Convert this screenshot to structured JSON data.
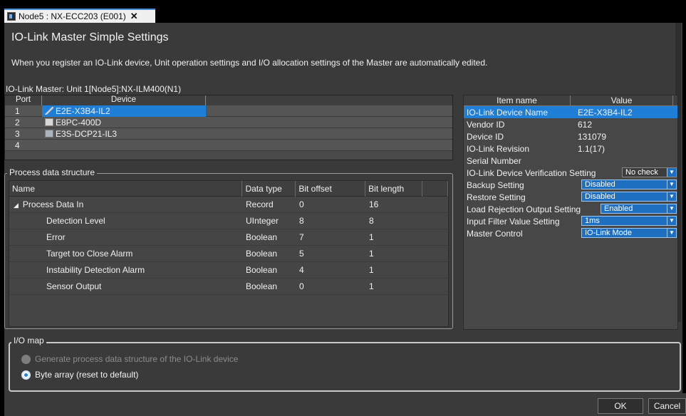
{
  "tab": {
    "title": "Node5 : NX-ECC203 (E001)",
    "close": "✕"
  },
  "header": {
    "title": "IO-Link Master Simple Settings",
    "description": "When you register an IO-Link device, Unit operation settings and I/O allocation settings of the Master are automatically edited."
  },
  "master_label": "IO-Link Master:  Unit 1[Node5]:NX-ILM400(N1)",
  "ports": {
    "headers": [
      "Port",
      "Device"
    ],
    "rows": [
      {
        "port": "1",
        "device": "E2E-X3B4-IL2",
        "icon": "sensor-icon",
        "selected": true
      },
      {
        "port": "2",
        "device": "E8PC-400D",
        "icon": "pressure-sensor-icon",
        "selected": false
      },
      {
        "port": "3",
        "device": "E3S-DCP21-IL3",
        "icon": "photoelectric-sensor-icon",
        "selected": false
      },
      {
        "port": "4",
        "device": "",
        "icon": "",
        "selected": false
      }
    ]
  },
  "process_data": {
    "legend": "Process data structure",
    "headers": [
      "Name",
      "Data type",
      "Bit offset",
      "Bit length"
    ],
    "rows": [
      {
        "name": "Process Data In",
        "type": "Record",
        "offset": "0",
        "length": "16",
        "expander": "◢"
      },
      {
        "name": "Detection Level",
        "type": "UInteger",
        "offset": "8",
        "length": "8"
      },
      {
        "name": "Error",
        "type": "Boolean",
        "offset": "7",
        "length": "1"
      },
      {
        "name": "Target too Close Alarm",
        "type": "Boolean",
        "offset": "5",
        "length": "1"
      },
      {
        "name": "Instability Detection Alarm",
        "type": "Boolean",
        "offset": "4",
        "length": "1"
      },
      {
        "name": "Sensor Output",
        "type": "Boolean",
        "offset": "0",
        "length": "1"
      }
    ]
  },
  "properties": {
    "headers": [
      "Item name",
      "Value"
    ],
    "rows": [
      {
        "name": "IO-Link Device Name",
        "value": "E2E-X3B4-IL2"
      },
      {
        "name": "Vendor ID",
        "value": "612"
      },
      {
        "name": "Device ID",
        "value": "131079"
      },
      {
        "name": "IO-Link Revision",
        "value": "1.1(17)"
      },
      {
        "name": "Serial Number",
        "value": ""
      },
      {
        "name": "IO-Link Device Verification Setting",
        "value": "No check"
      },
      {
        "name": "Backup Setting",
        "value": "Disabled"
      },
      {
        "name": "Restore Setting",
        "value": "Disabled"
      },
      {
        "name": "Load Rejection Output Setting",
        "value": "Enabled"
      },
      {
        "name": "Input Filter Value Setting",
        "value": "1ms"
      },
      {
        "name": "Master Control",
        "value": "IO-Link Mode"
      }
    ],
    "dropdown_arrow": "▼"
  },
  "iomap": {
    "legend": "I/O map",
    "options": [
      {
        "label": "Generate process data structure of the IO-Link device",
        "selected": false,
        "enabled": false
      },
      {
        "label": "Byte array (reset to default)",
        "selected": true,
        "enabled": true
      }
    ]
  },
  "buttons": {
    "ok": "OK",
    "cancel": "Cancel"
  },
  "colors": {
    "selection": "#1f7fd6",
    "background": "#3a3a3a",
    "panel": "#474747"
  }
}
